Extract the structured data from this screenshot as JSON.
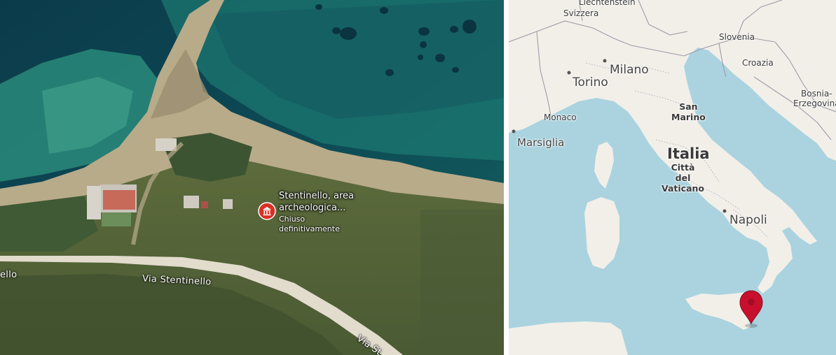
{
  "satellite": {
    "poi": {
      "name_line1": "Stentinello, area",
      "name_line2": "archeologica...",
      "status_line1": "Chiuso",
      "status_line2": "definitivamente",
      "icon": "museum-icon",
      "pin_color": "#d93025"
    },
    "road_labels": {
      "main": "Via Stentinello",
      "left_fragment": "ello",
      "bottom_fragment": "Via St"
    }
  },
  "locator_map": {
    "labels": {
      "liechtenstein": "Liechtenstein",
      "svizzera": "Svizzera",
      "slovenia": "Slovenia",
      "croazia": "Croazia",
      "bosnia_line1": "Bosnia-",
      "bosnia_line2": "Erzegovina",
      "milano": "Milano",
      "torino": "Torino",
      "monaco": "Monaco",
      "marsiglia": "Marsiglia",
      "san_marino_line1": "San",
      "san_marino_line2": "Marino",
      "italia": "Italia",
      "vaticano_line1": "Città",
      "vaticano_line2": "del",
      "vaticano_line3": "Vaticano",
      "napoli": "Napoli"
    },
    "marker": {
      "icon": "location-pin-icon",
      "color": "#c8102e"
    },
    "colors": {
      "sea": "#aad3df",
      "land": "#f2efe9",
      "border": "#9e9aa8"
    }
  }
}
